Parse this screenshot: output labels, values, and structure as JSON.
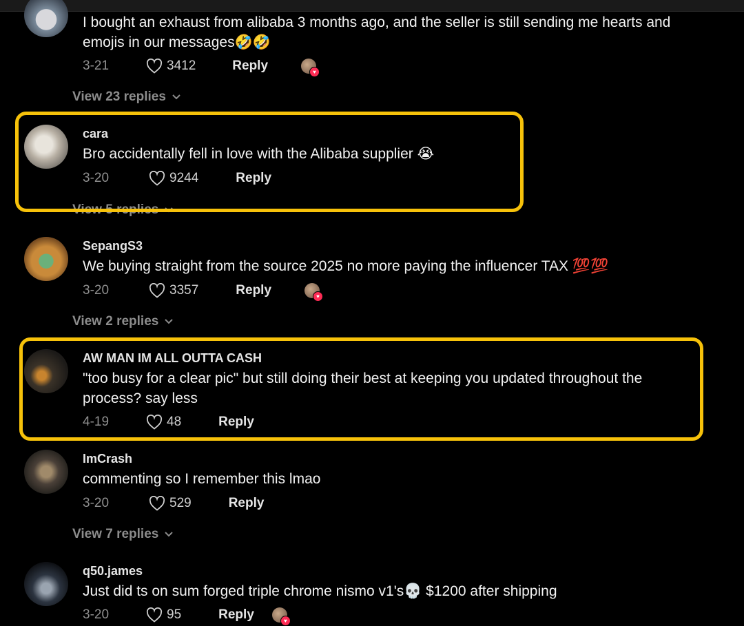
{
  "colors": {
    "background": "#000000",
    "highlight": "#f7c20a",
    "muted_text": "#8f8f8f",
    "like_badge": "#fe2c55"
  },
  "icons": {
    "heart": "heart-outline-icon",
    "chevron": "chevron-down-icon",
    "creator_liked": "creator-liked-avatar-icon"
  },
  "comments": [
    {
      "username": "",
      "text": "I bought an exhaust from alibaba 3 months ago, and the seller is still sending me hearts and emojis in our messages🤣🤣",
      "date": "3-21",
      "likes": "3412",
      "reply_label": "Reply",
      "creator_liked": true,
      "view_replies": "View 23 replies"
    },
    {
      "username": "cara",
      "text": "Bro accidentally fell in love with the Alibaba supplier 😭",
      "date": "3-20",
      "likes": "9244",
      "reply_label": "Reply",
      "creator_liked": false,
      "view_replies": "View 5 replies"
    },
    {
      "username": "SepangS3",
      "text": "We buying straight from the source 2025 no more paying the influencer TAX 💯💯",
      "date": "3-20",
      "likes": "3357",
      "reply_label": "Reply",
      "creator_liked": true,
      "view_replies": "View 2 replies"
    },
    {
      "username": "AW MAN IM ALL OUTTA CASH",
      "text": "\"too busy for a clear pic\" but still doing their best at keeping you updated throughout the process? say less",
      "date": "4-19",
      "likes": "48",
      "reply_label": "Reply",
      "creator_liked": false,
      "view_replies": ""
    },
    {
      "username": "ImCrash",
      "text": "commenting so I remember this lmao",
      "date": "3-20",
      "likes": "529",
      "reply_label": "Reply",
      "creator_liked": false,
      "view_replies": "View 7 replies"
    },
    {
      "username": "q50.james",
      "text": "Just did ts on sum forged triple chrome nismo v1's💀 $1200 after shipping",
      "date": "3-20",
      "likes": "95",
      "reply_label": "Reply",
      "creator_liked": true,
      "view_replies": ""
    }
  ]
}
